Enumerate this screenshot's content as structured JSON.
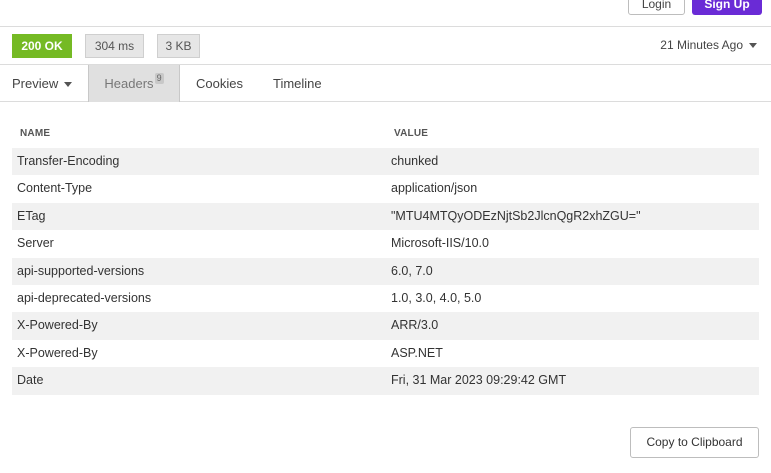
{
  "topbar": {
    "login_label": "Login",
    "signup_label": "Sign Up"
  },
  "status": {
    "code_label": "200 OK",
    "time_label": "304 ms",
    "size_label": "3 KB",
    "time_ago": "21 Minutes Ago"
  },
  "tabs": [
    {
      "label": "Preview"
    },
    {
      "label": "Headers",
      "badge": "9"
    },
    {
      "label": "Cookies"
    },
    {
      "label": "Timeline"
    }
  ],
  "colors": {
    "status_ok": "#75ba24",
    "signup": "#6a2bd6"
  },
  "headers_table": {
    "columns": [
      "NAME",
      "VALUE"
    ],
    "rows": [
      {
        "name": "Transfer-Encoding",
        "value": "chunked"
      },
      {
        "name": "Content-Type",
        "value": "application/json"
      },
      {
        "name": "ETag",
        "value": "\"MTU4MTQyODEzNjtSb2JlcnQgR2xhZGU=\""
      },
      {
        "name": "Server",
        "value": "Microsoft-IIS/10.0"
      },
      {
        "name": "api-supported-versions",
        "value": "6.0, 7.0"
      },
      {
        "name": "api-deprecated-versions",
        "value": "1.0, 3.0, 4.0, 5.0"
      },
      {
        "name": "X-Powered-By",
        "value": "ARR/3.0"
      },
      {
        "name": "X-Powered-By",
        "value": "ASP.NET"
      },
      {
        "name": "Date",
        "value": "Fri, 31 Mar 2023 09:29:42 GMT"
      }
    ]
  },
  "copy_label": "Copy to Clipboard"
}
